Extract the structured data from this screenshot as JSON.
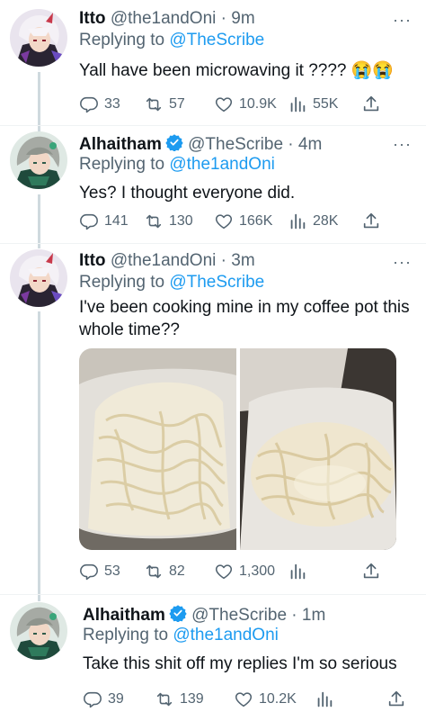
{
  "tweets": [
    {
      "name": "Itto",
      "handle": "@the1andOni · 9m",
      "replying_prefix": "Replying to",
      "replying_to": "@TheScribe",
      "text": "Yall have been microwaving it ???? 😭😭",
      "more": "···",
      "actions": {
        "replies": "33",
        "retweets": "57",
        "likes": "10.9K",
        "views": "55K"
      },
      "avatar": "itto-avatar"
    },
    {
      "name": "Alhaitham",
      "handle": "@TheScribe · 4m",
      "replying_prefix": "Replying to",
      "replying_to": "@the1andOni",
      "text": "Yes? I thought everyone did.",
      "more": "···",
      "actions": {
        "replies": "141",
        "retweets": "130",
        "likes": "166K",
        "views": "28K"
      },
      "avatar": "alhaitham-avatar"
    },
    {
      "name": "Itto",
      "handle": "@the1andOni · 3m",
      "replying_prefix": "Replying to",
      "replying_to": "@TheScribe",
      "text": "I've been cooking mine in my coffee pot this whole time??",
      "more": "···",
      "media": [
        "noodles-in-coffee-pot-photo",
        "noodles-in-coffee-pot-photo-2"
      ],
      "actions": {
        "replies": "53",
        "retweets": "82",
        "likes": "1,300",
        "views": ""
      },
      "avatar": "itto-avatar"
    },
    {
      "name": "Alhaitham",
      "handle": "@TheScribe · 1m",
      "replying_prefix": "Replying to",
      "replying_to": "@the1andOni",
      "text": "Take this shit off my replies I'm so serious",
      "actions": {
        "replies": "39",
        "retweets": "139",
        "likes": "10.2K",
        "views": ""
      },
      "avatar": "alhaitham-avatar"
    }
  ],
  "colors": {
    "accent": "#1d9bf0",
    "muted": "#536471",
    "thread_line": "#cfd9de",
    "verified": "#1d9bf0"
  },
  "icons": [
    "reply-icon",
    "retweet-icon",
    "like-icon",
    "views-icon",
    "share-icon",
    "verified-badge-icon",
    "more-icon"
  ]
}
